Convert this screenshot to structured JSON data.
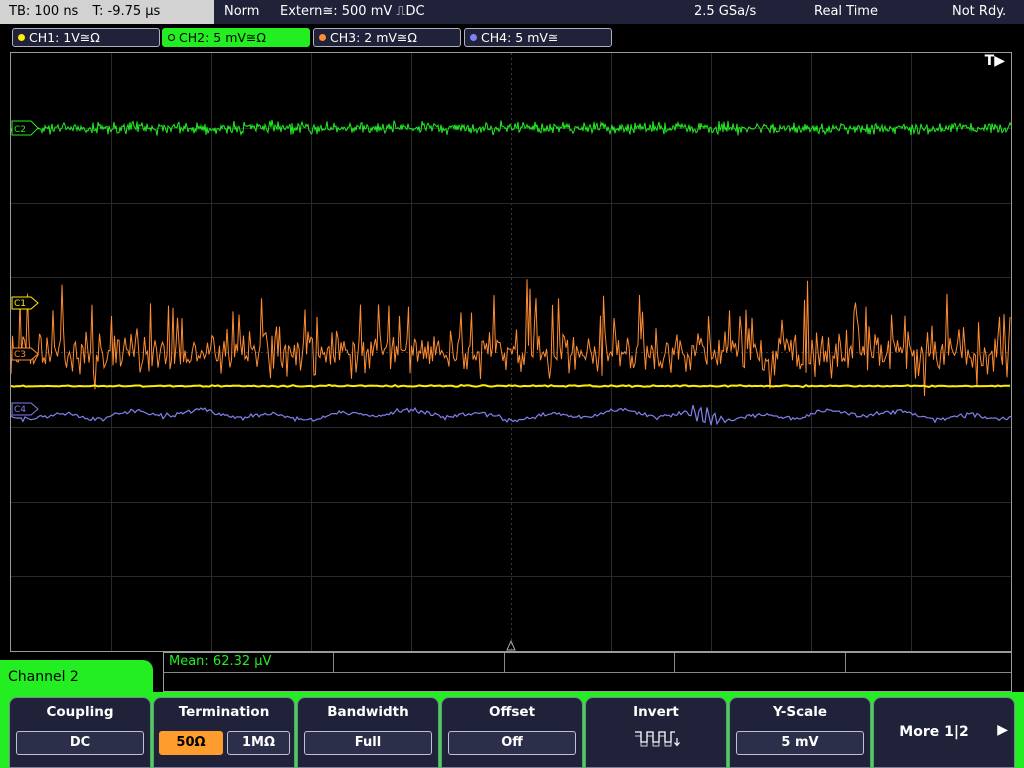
{
  "status": {
    "timebase": "TB: 100 ns",
    "trigger_time": "T: -9.75 µs",
    "mode": "Norm",
    "trigger_source": "Extern≅: 500 mV ⎍DC",
    "sample_rate": "2.5 GSa/s",
    "acquisition": "Real Time",
    "state": "Not Rdy."
  },
  "channels": [
    {
      "label": "CH1: 1V≅Ω",
      "color": "#ffee00",
      "active": false
    },
    {
      "label": "CH2: 5 mV≅Ω",
      "color": "#22ee22",
      "active": true
    },
    {
      "label": "CH3: 2 mV≅Ω",
      "color": "#ff8c30",
      "active": false
    },
    {
      "label": "CH4: 5 mV≅",
      "color": "#8080ee",
      "active": false
    }
  ],
  "screen": {
    "trigger_marker": "T▶",
    "markers": {
      "c1": "C1",
      "c3": "C3",
      "c4": "C4",
      "c2": "C2"
    }
  },
  "measurement": {
    "mean": "Mean: 62.32 µV"
  },
  "menu": {
    "channel_label": "Channel 2",
    "coupling": {
      "title": "Coupling",
      "value": "DC"
    },
    "termination": {
      "title": "Termination",
      "options": [
        "50Ω",
        "1MΩ"
      ],
      "selected": 0
    },
    "bandwidth": {
      "title": "Bandwidth",
      "value": "Full"
    },
    "offset": {
      "title": "Offset",
      "value": "Off"
    },
    "invert": {
      "title": "Invert",
      "icon": "inverted-square-wave-icon"
    },
    "yscale": {
      "title": "Y-Scale",
      "value": "5 mV"
    },
    "more": {
      "label": "More 1|2"
    }
  }
}
